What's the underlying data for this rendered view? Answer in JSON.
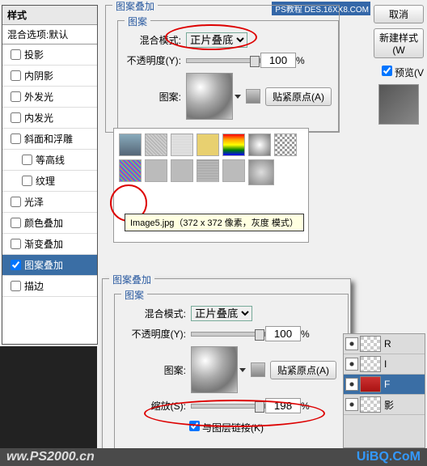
{
  "styles": {
    "title": "样式",
    "subtitle": "混合选项:默认",
    "items": [
      "投影",
      "内阴影",
      "外发光",
      "内发光",
      "斜面和浮雕",
      "等高线",
      "纹理",
      "光泽",
      "颜色叠加",
      "渐变叠加",
      "图案叠加",
      "描边"
    ]
  },
  "top": {
    "group": "图案叠加",
    "sub": "图案",
    "blend_label": "混合模式:",
    "blend_value": "正片叠底",
    "opacity_label": "不透明度(Y):",
    "opacity_value": "100",
    "percent": "%",
    "pattern_label": "图案:",
    "snap": "贴紧原点(A)"
  },
  "tooltip": "Image5.jpg（372 x 372 像素，灰度 模式）",
  "bottom": {
    "group": "图案叠加",
    "sub": "图案",
    "blend_label": "混合模式:",
    "blend_value": "正片叠底",
    "opacity_label": "不透明度(Y):",
    "opacity_value": "100",
    "percent": "%",
    "pattern_label": "图案:",
    "snap": "贴紧原点(A)",
    "scale_label": "缩放(S):",
    "scale_value": "198",
    "link": "与图层链接(K)"
  },
  "right": {
    "cancel": "取消",
    "new_style": "新建样式(W",
    "preview": "预览(V"
  },
  "layers": [
    "R",
    "I",
    "F",
    "影"
  ],
  "footer": "ww.PS2000.cn",
  "uibq": "UiBQ.CoM",
  "watermark": "PS教程\nDES.16XX8.COM"
}
